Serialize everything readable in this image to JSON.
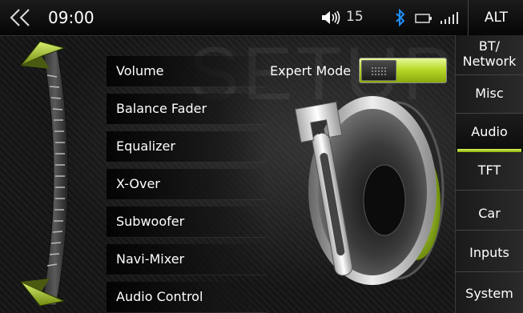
{
  "status": {
    "time": "09:00",
    "volume": "15",
    "alt_label": "ALT"
  },
  "watermark": "SETUP",
  "menu": [
    {
      "label": "Volume"
    },
    {
      "label": "Balance Fader"
    },
    {
      "label": "Equalizer"
    },
    {
      "label": "X-Over"
    },
    {
      "label": "Subwoofer"
    },
    {
      "label": "Navi-Mixer"
    },
    {
      "label": "Audio Control"
    }
  ],
  "expert_mode": {
    "label": "Expert Mode",
    "on": true
  },
  "tabs": [
    {
      "label_line1": "BT/",
      "label_line2": "Network"
    },
    {
      "label": "Misc"
    },
    {
      "label": "Audio",
      "active": true
    },
    {
      "label": "TFT"
    },
    {
      "label": "Car"
    },
    {
      "label": "Inputs"
    },
    {
      "label": "System"
    }
  ],
  "colors": {
    "accent": "#b8d92a",
    "background": "#111111"
  }
}
